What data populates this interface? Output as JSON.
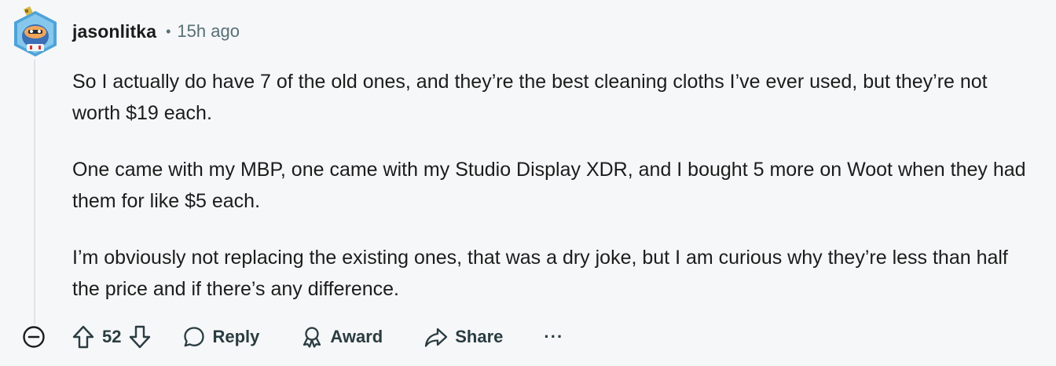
{
  "comment": {
    "username": "jasonlitka",
    "separator": "•",
    "timestamp": "15h ago",
    "paragraphs": [
      "So I actually do have 7 of the old ones, and they’re the best cleaning cloths I’ve ever used, but they’re not worth $19 each.",
      "One came with my MBP, one came with my Studio Display XDR, and I bought 5 more on Woot when they had them for like $5 each.",
      "I’m obviously not replacing the existing ones, that was a dry joke, but I am curious why they’re less than half the price and if there’s any difference."
    ]
  },
  "actions": {
    "vote_count": "52",
    "reply_label": "Reply",
    "award_label": "Award",
    "share_label": "Share",
    "more_label": "···"
  },
  "icons": {
    "avatar": "avatar-icon",
    "collapse": "minus-circle-icon",
    "upvote": "arrow-up-icon",
    "downvote": "arrow-down-icon",
    "reply": "speech-bubble-icon",
    "award": "award-ribbon-icon",
    "share": "share-arrow-icon"
  },
  "colors": {
    "background": "#f6f7f8",
    "text": "#1c1c1c",
    "meta": "#576f76",
    "action": "#2a3c42",
    "thread_line": "#e1e4e6"
  }
}
